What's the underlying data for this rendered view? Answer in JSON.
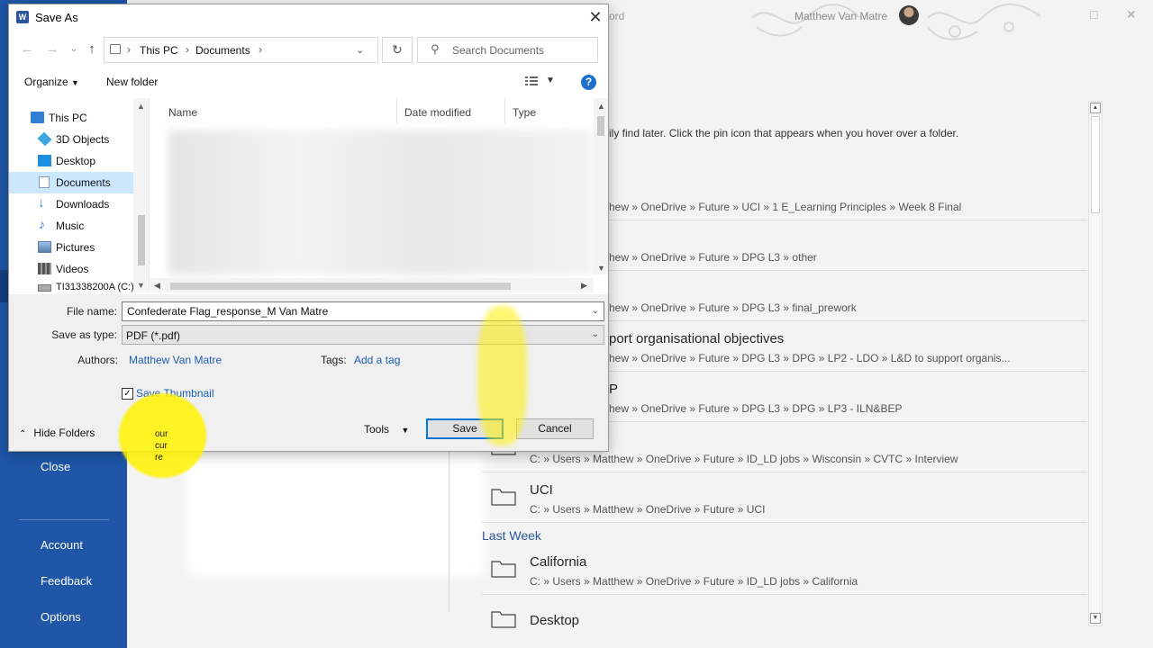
{
  "word": {
    "title_fragment": "ord",
    "user_name": "Matthew Van Matre",
    "sidebar": {
      "close": "Close",
      "account": "Account",
      "feedback": "Feedback",
      "options": "Options"
    },
    "pin_tip": "ily find later. Click the pin icon that appears when you hover over a folder.",
    "last_week": "Last Week",
    "recent_rows": [
      {
        "name": "",
        "path": "hew » OneDrive » Future » UCI » 1 E_Learning Principles » Week 8 Final"
      },
      {
        "name": "",
        "path": "hew » OneDrive » Future » DPG L3 » other"
      },
      {
        "name": "",
        "path": "hew » OneDrive » Future » DPG L3 » final_prework"
      },
      {
        "name": "port organisational objectives",
        "path": "hew » OneDrive » Future » DPG L3 » DPG » LP2 - LDO » L&D to support organis..."
      },
      {
        "name": "P",
        "path": "hew » OneDrive » Future » DPG L3 » DPG » LP3 - ILN&BEP"
      },
      {
        "name": "",
        "path": "C: » Users » Matthew » OneDrive » Future » ID_LD jobs » Wisconsin » CVTC » Interview"
      },
      {
        "name": "UCI",
        "path": "C: » Users » Matthew » OneDrive » Future » UCI"
      },
      {
        "name": "California",
        "path": "C: » Users » Matthew » OneDrive » Future » ID_LD jobs » California"
      },
      {
        "name": "Desktop",
        "path": ""
      }
    ],
    "overlay_text": [
      "our",
      "cur",
      "re"
    ]
  },
  "dialog": {
    "title": "Save As",
    "address": {
      "crumbs": [
        "This PC",
        "Documents"
      ]
    },
    "search_placeholder": "Search Documents",
    "toolbar": {
      "organize": "Organize",
      "new_folder": "New folder",
      "help": "?"
    },
    "nav_tree": [
      {
        "label": "This PC",
        "icon": "pc-icon",
        "color": "#2f7fd6"
      },
      {
        "label": "3D Objects",
        "icon": "cube-icon",
        "color": "#3fa7e0"
      },
      {
        "label": "Desktop",
        "icon": "desktop-icon",
        "color": "#1e8fe0"
      },
      {
        "label": "Documents",
        "icon": "documents-icon",
        "color": "#8a9bb0"
      },
      {
        "label": "Downloads",
        "icon": "download-icon",
        "color": "#2f7fd6"
      },
      {
        "label": "Music",
        "icon": "music-icon",
        "color": "#2f7fd6"
      },
      {
        "label": "Pictures",
        "icon": "pictures-icon",
        "color": "#5a7fa8"
      },
      {
        "label": "Videos",
        "icon": "videos-icon",
        "color": "#555555"
      },
      {
        "label": "TI31338200A (C:)",
        "icon": "drive-icon",
        "color": "#777777"
      }
    ],
    "columns": [
      "Name",
      "Date modified",
      "Type"
    ],
    "form": {
      "file_name_label": "File name:",
      "file_name_value": "Confederate Flag_response_M Van Matre",
      "save_type_label": "Save as type:",
      "save_type_value": "PDF (*.pdf)",
      "authors_label": "Authors:",
      "authors_value": "Matthew Van Matre",
      "tags_label": "Tags:",
      "tags_value": "Add a tag",
      "save_thumbnail": "Save Thumbnail",
      "thumbnail_checked": "✓",
      "hide_folders": "Hide Folders",
      "tools": "Tools",
      "save": "Save",
      "cancel": "Cancel"
    }
  },
  "colors": {
    "word_blue": "#1f56a8",
    "link_blue": "#1a5fb4",
    "selection": "#cce8ff",
    "highlighter": "#fff200"
  }
}
